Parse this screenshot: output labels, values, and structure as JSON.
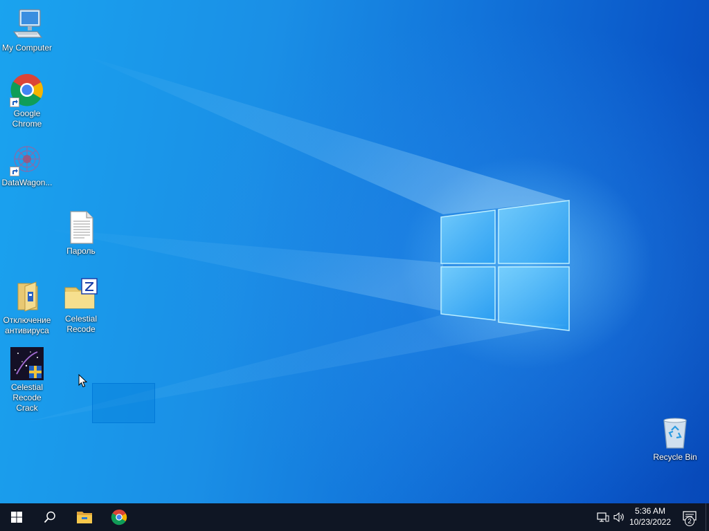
{
  "desktop": {
    "icons": [
      {
        "label": "My Computer"
      },
      {
        "label": "Google Chrome"
      },
      {
        "label": "DataWagon..."
      },
      {
        "label": "Пароль"
      },
      {
        "label": "Отключение антивируса"
      },
      {
        "label": "Celestial Recode"
      },
      {
        "label": "Celestial Recode Crack"
      },
      {
        "label": "Recycle Bin"
      }
    ]
  },
  "taskbar": {
    "start_icon": "windows-logo-icon",
    "search_icon": "search-icon",
    "pinned": [
      {
        "icon": "file-explorer-icon"
      },
      {
        "icon": "chrome-icon"
      }
    ],
    "tray": {
      "network_icon": "network-icon",
      "volume_icon": "volume-icon",
      "time": "5:36 AM",
      "date": "10/23/2022",
      "notification_icon": "action-center-icon",
      "notification_count": "2"
    }
  },
  "colors": {
    "taskbar_bg": "#0f1624",
    "desktop_accent": "#1274da",
    "selection": "#0078d7"
  }
}
